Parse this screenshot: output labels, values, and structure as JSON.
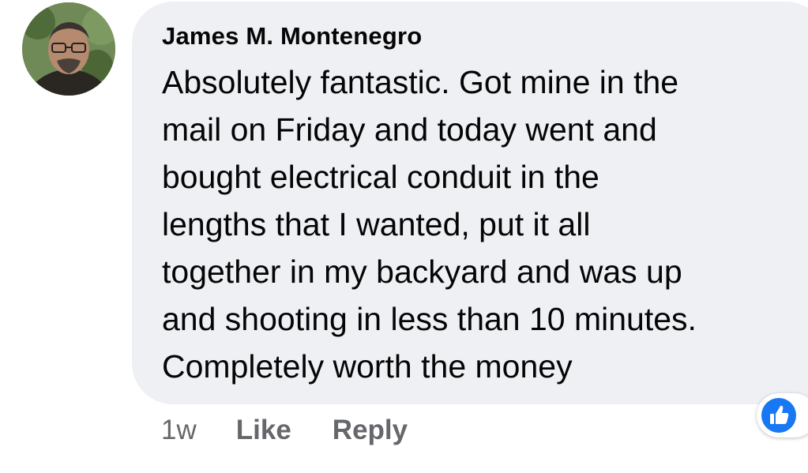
{
  "comment": {
    "author": "James M. Montenegro",
    "text": "Absolutely fantastic. Got mine in the\nmail on Friday and today went and\nbought electrical conduit in the\nlengths that I wanted, put it all\ntogether in my backyard and was up\nand shooting in less than 10 minutes.\nCompletely worth the money",
    "timestamp": "1w",
    "like_label": "Like",
    "reply_label": "Reply",
    "reaction_icon": "thumbs-up-icon"
  },
  "colors": {
    "bubble_background": "#eff0f4",
    "text_primary": "#050505",
    "text_secondary": "#65676b",
    "like_blue": "#1877f2"
  }
}
